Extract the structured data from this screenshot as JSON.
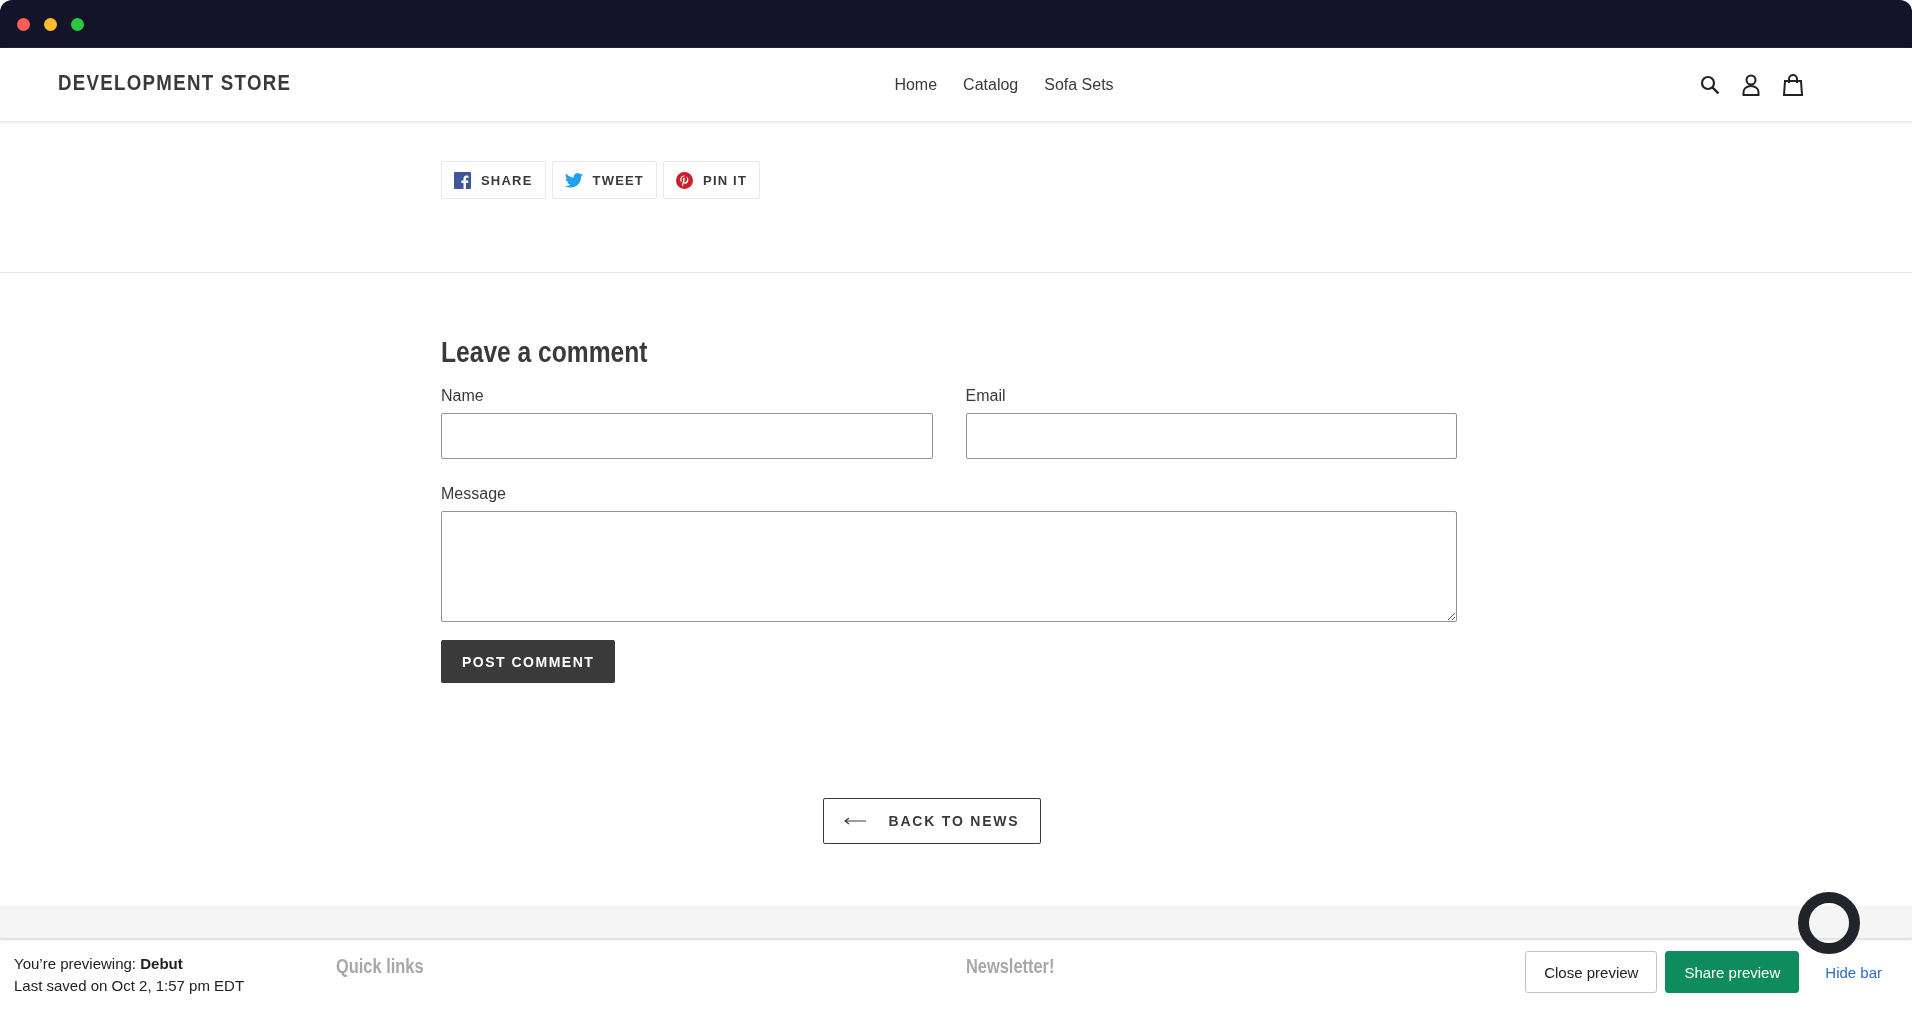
{
  "store": {
    "name": "DEVELOPMENT STORE",
    "nav": [
      {
        "label": "Home"
      },
      {
        "label": "Catalog"
      },
      {
        "label": "Sofa Sets"
      }
    ]
  },
  "share": [
    {
      "kind": "facebook",
      "label": "SHARE"
    },
    {
      "kind": "twitter",
      "label": "TWEET"
    },
    {
      "kind": "pinterest",
      "label": "PIN IT"
    }
  ],
  "comment_form": {
    "title": "Leave a comment",
    "fields": [
      {
        "label": "Name",
        "kind": "input"
      },
      {
        "label": "Email",
        "kind": "input"
      },
      {
        "label": "Message",
        "kind": "textarea"
      }
    ],
    "submit": "POST COMMENT"
  },
  "back_link": "BACK TO NEWS",
  "footer": {
    "headings": [
      "Quick links",
      "Newsletter!"
    ]
  },
  "preview_bar": {
    "previewing": "You’re previewing: **Debut**",
    "saved": "Last saved on Oct 2, 1:57 pm EDT",
    "close": "Close preview",
    "share": "Share preview",
    "hide": "Hide bar"
  }
}
